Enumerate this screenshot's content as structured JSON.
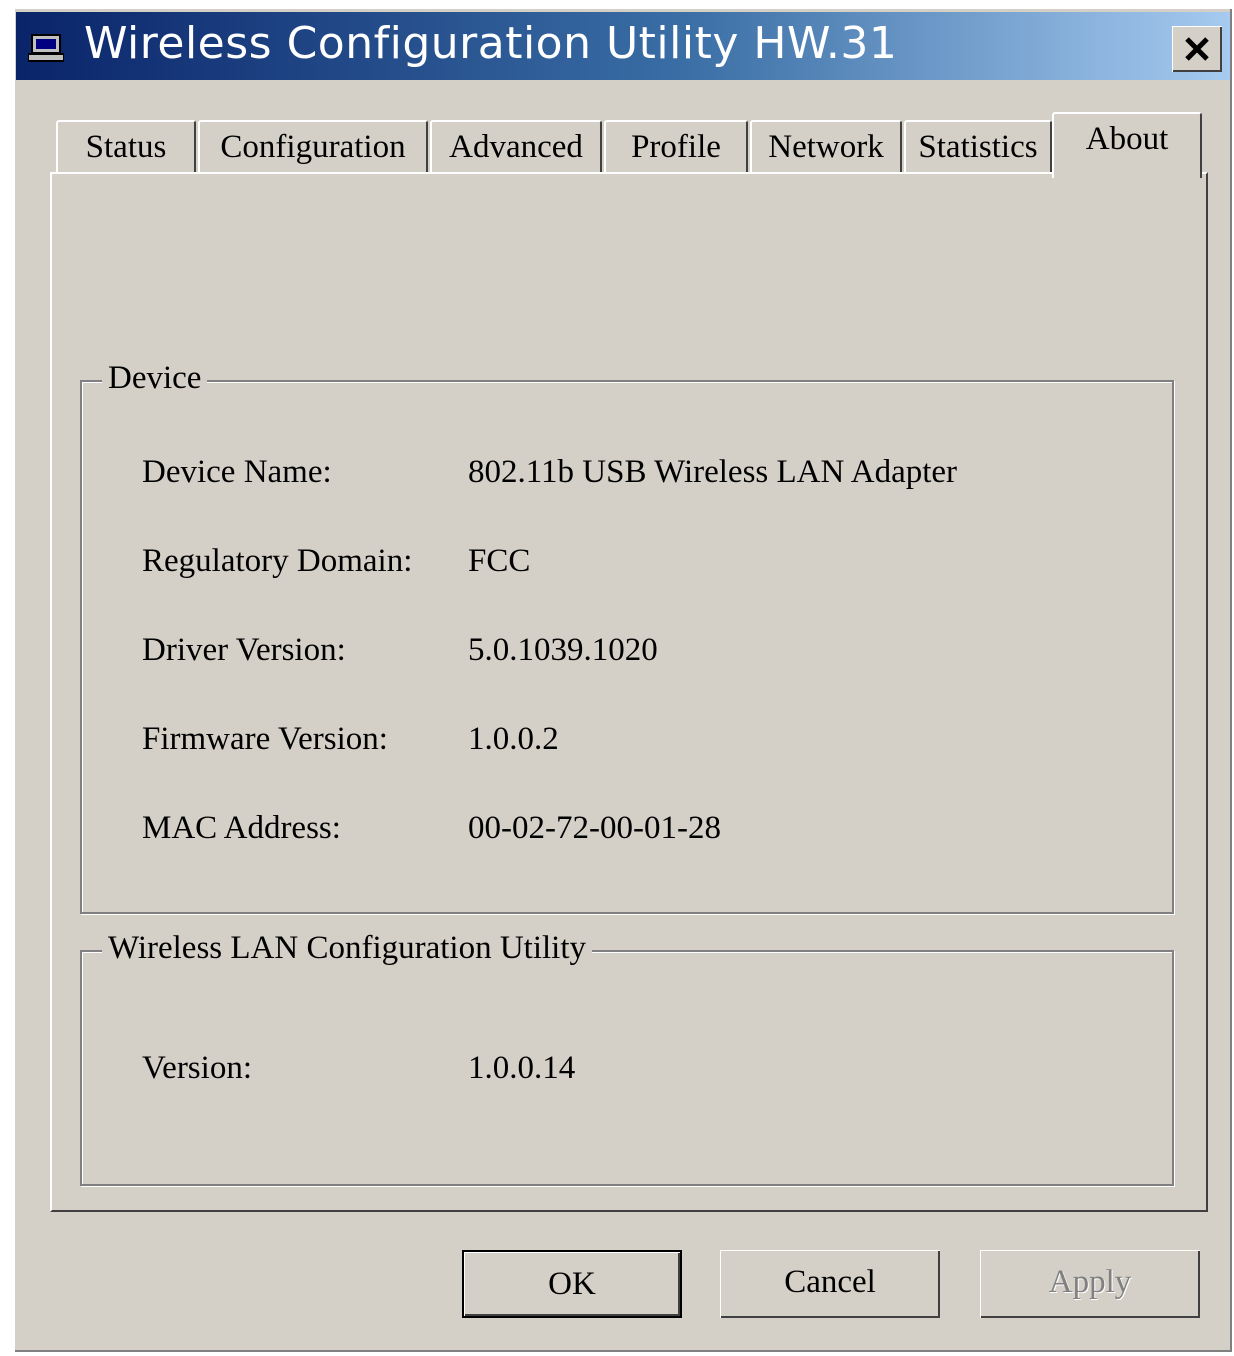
{
  "window": {
    "title": "Wireless Configuration Utility HW.31",
    "title_icon": "computer-icon",
    "close_icon": "close-x-icon",
    "titlebar_color": "#0a246a"
  },
  "tabs": [
    {
      "label": "Status",
      "active": false
    },
    {
      "label": "Configuration",
      "active": false
    },
    {
      "label": "Advanced",
      "active": false
    },
    {
      "label": "Profile",
      "active": false
    },
    {
      "label": "Network",
      "active": false
    },
    {
      "label": "Statistics",
      "active": false
    },
    {
      "label": "About",
      "active": true
    }
  ],
  "device_group": {
    "legend": "Device",
    "rows": [
      {
        "label": "Device Name:",
        "value": "802.11b USB Wireless LAN Adapter"
      },
      {
        "label": "Regulatory Domain:",
        "value": "FCC"
      },
      {
        "label": "Driver Version:",
        "value": "5.0.1039.1020"
      },
      {
        "label": "Firmware Version:",
        "value": "1.0.0.2"
      },
      {
        "label": "MAC Address:",
        "value": "00-02-72-00-01-28"
      }
    ]
  },
  "utility_group": {
    "legend": "Wireless LAN Configuration Utility",
    "rows": [
      {
        "label": "Version:",
        "value": "1.0.0.14"
      }
    ]
  },
  "buttons": {
    "ok": "OK",
    "cancel": "Cancel",
    "apply": "Apply"
  }
}
